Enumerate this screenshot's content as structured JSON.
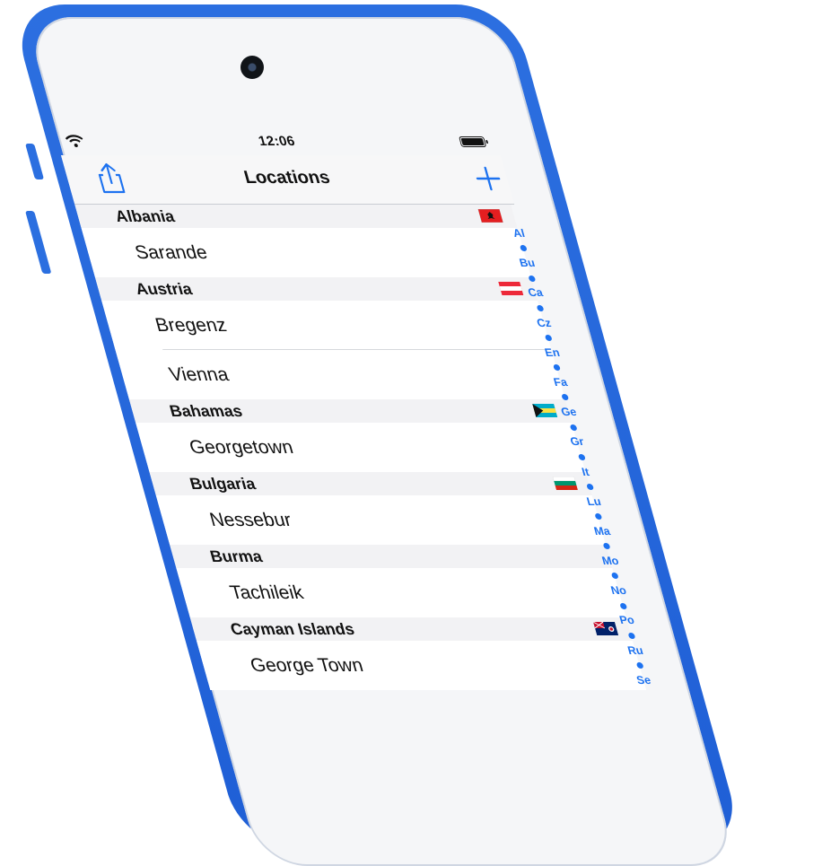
{
  "status_bar": {
    "time": "12:06"
  },
  "nav": {
    "title": "Locations",
    "left_icon": "share-icon",
    "right_icon": "plus-icon"
  },
  "colors": {
    "accent": "#1d72f0",
    "device": "#2b6fe0",
    "screen_bg": "#f5f6f8"
  },
  "sections": [
    {
      "name": "Albania",
      "flag": "albania-flag",
      "rows": [
        "Sarande"
      ]
    },
    {
      "name": "Austria",
      "flag": "austria-flag",
      "rows": [
        "Bregenz",
        "Vienna"
      ]
    },
    {
      "name": "Bahamas",
      "flag": "bahamas-flag",
      "rows": [
        "Georgetown"
      ]
    },
    {
      "name": "Bulgaria",
      "flag": "bulgaria-flag",
      "rows": [
        "Nessebur"
      ]
    },
    {
      "name": "Burma",
      "flag": "",
      "rows": [
        "Tachileik"
      ]
    },
    {
      "name": "Cayman Islands",
      "flag": "cayman-islands-flag",
      "rows": [
        "George Town"
      ]
    }
  ],
  "index": [
    "Al",
    "Bu",
    "Ca",
    "Cz",
    "En",
    "Fa",
    "Ge",
    "Gr",
    "It",
    "Lu",
    "Ma",
    "Mo",
    "No",
    "Po",
    "Ru",
    "Se"
  ]
}
